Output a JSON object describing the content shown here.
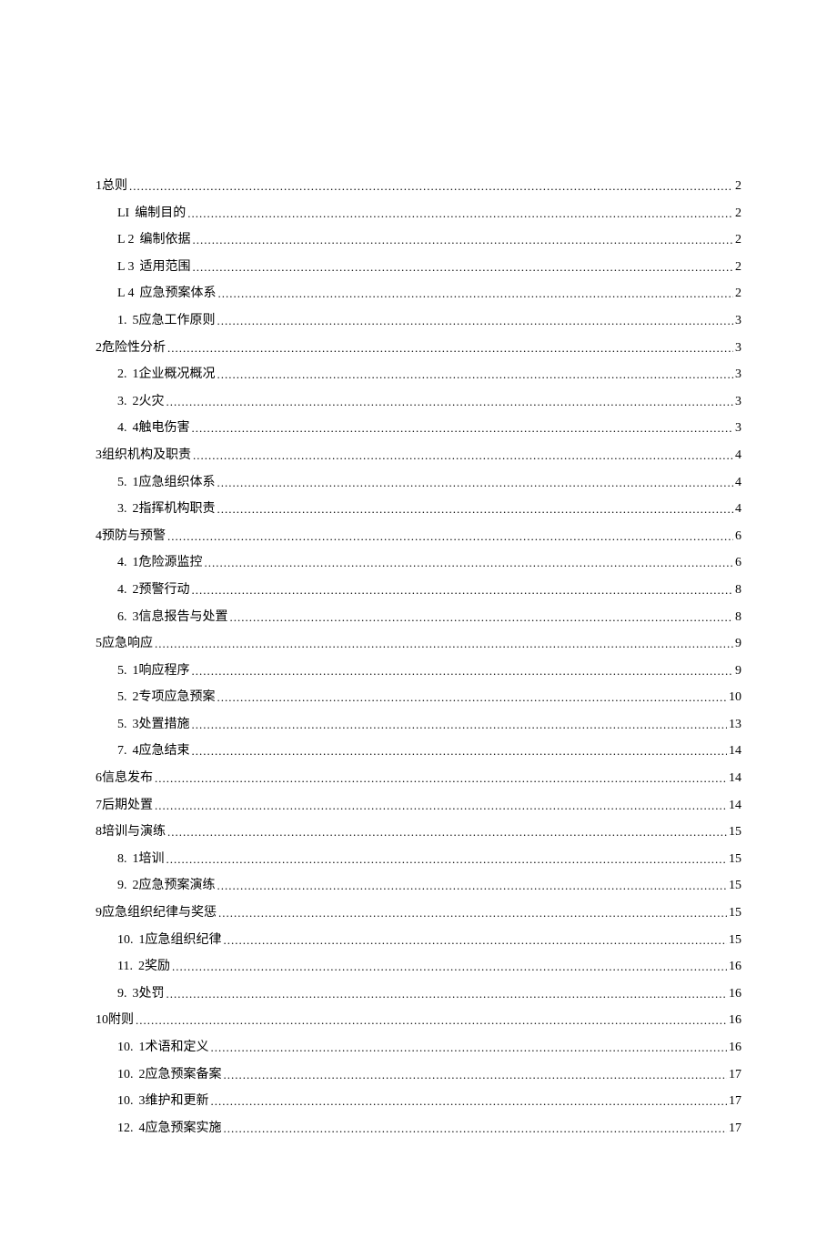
{
  "toc": [
    {
      "level": 1,
      "num": "1",
      "title": "总则",
      "page": "2"
    },
    {
      "level": 2,
      "num": "LI",
      "title": "编制目的",
      "page": "2"
    },
    {
      "level": 2,
      "num": "L 2",
      "title": "编制依据",
      "page": "2"
    },
    {
      "level": 2,
      "num": "L 3",
      "title": "适用范围",
      "page": "2"
    },
    {
      "level": 2,
      "num": "L 4",
      "title": "应急预案体系",
      "page": "2"
    },
    {
      "level": 2,
      "num": "1.",
      "title": "5应急工作原则",
      "page": "3"
    },
    {
      "level": 1,
      "num": "2",
      "title": "危险性分析",
      "page": "3"
    },
    {
      "level": 2,
      "num": "2.",
      "title": "1企业概况概况",
      "page": "3"
    },
    {
      "level": 2,
      "num": "3.",
      "title": "2火灾",
      "page": "3"
    },
    {
      "level": 2,
      "num": "4.",
      "title": "4触电伤害",
      "page": "3"
    },
    {
      "level": 1,
      "num": "3",
      "title": "组织机构及职责",
      "page": "4"
    },
    {
      "level": 2,
      "num": "5.",
      "title": "1应急组织体系",
      "page": "4"
    },
    {
      "level": 2,
      "num": "3.",
      "title": "2指挥机构职责",
      "page": "4"
    },
    {
      "level": 1,
      "num": "4",
      "title": "预防与预警",
      "page": "6"
    },
    {
      "level": 2,
      "num": "4.",
      "title": "1危险源监控",
      "page": "6"
    },
    {
      "level": 2,
      "num": "4.",
      "title": "2预警行动",
      "page": "8"
    },
    {
      "level": 2,
      "num": "6.",
      "title": "3信息报告与处置",
      "page": "8"
    },
    {
      "level": 1,
      "num": "5",
      "title": "应急响应",
      "page": "9"
    },
    {
      "level": 2,
      "num": "5.",
      "title": "1响应程序",
      "page": "9"
    },
    {
      "level": 2,
      "num": "5.",
      "title": "2专项应急预案",
      "page": "10"
    },
    {
      "level": 2,
      "num": "5.",
      "title": "3处置措施",
      "page": "13"
    },
    {
      "level": 2,
      "num": "7.",
      "title": "4应急结束",
      "page": "14"
    },
    {
      "level": 1,
      "num": "6",
      "title": "信息发布",
      "page": "14"
    },
    {
      "level": 1,
      "num": "7",
      "title": "后期处置",
      "page": "14"
    },
    {
      "level": 1,
      "num": "8",
      "title": "培训与演练",
      "page": "15"
    },
    {
      "level": 2,
      "num": "8.",
      "title": "1培训",
      "page": "15"
    },
    {
      "level": 2,
      "num": "9.",
      "title": "2应急预案演练",
      "page": "15"
    },
    {
      "level": 1,
      "num": "9",
      "title": "应急组织纪律与奖惩",
      "page": "15"
    },
    {
      "level": 2,
      "num": "10.",
      "title": "1应急组织纪律",
      "page": "15"
    },
    {
      "level": 2,
      "num": "11.",
      "title": "2奖励",
      "page": "16"
    },
    {
      "level": 2,
      "num": "9.",
      "title": "3处罚",
      "page": "16"
    },
    {
      "level": 1,
      "num": "10",
      "title": "附则",
      "page": "16"
    },
    {
      "level": 2,
      "num": "10.",
      "title": "1术语和定义",
      "page": "16"
    },
    {
      "level": 2,
      "num": "10.",
      "title": "2应急预案备案",
      "page": "17"
    },
    {
      "level": 2,
      "num": "10.",
      "title": "3维护和更新",
      "page": "17"
    },
    {
      "level": 2,
      "num": "12.",
      "title": "4应急预案实施",
      "page": "17"
    }
  ]
}
